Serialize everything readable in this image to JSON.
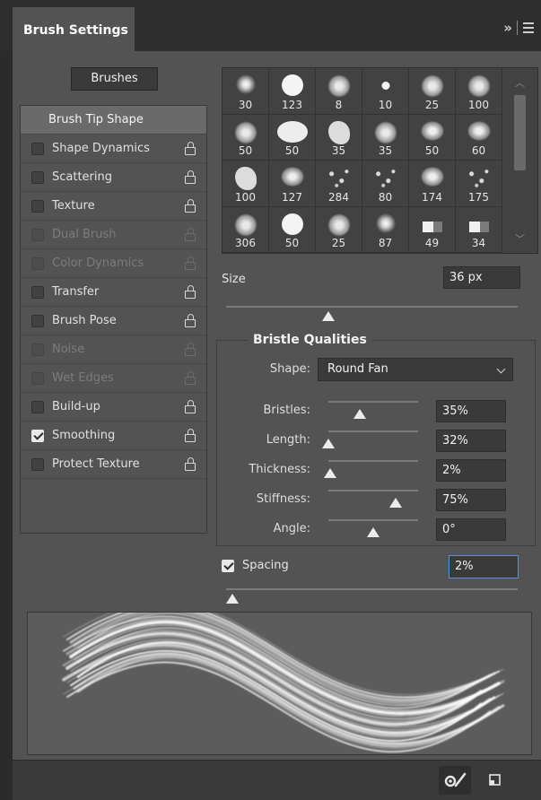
{
  "panel": {
    "tab_title": "Brush Settings",
    "header_icons": [
      "expand-icon",
      "menu-icon"
    ]
  },
  "brushes_button": "Brushes",
  "options": [
    {
      "label": "Brush Tip Shape",
      "selected": true
    },
    {
      "label": "Shape Dynamics",
      "checked": false,
      "enabled": true
    },
    {
      "label": "Scattering",
      "checked": false,
      "enabled": true
    },
    {
      "label": "Texture",
      "checked": false,
      "enabled": true
    },
    {
      "label": "Dual Brush",
      "checked": false,
      "enabled": false
    },
    {
      "label": "Color Dynamics",
      "checked": false,
      "enabled": false
    },
    {
      "label": "Transfer",
      "checked": false,
      "enabled": true
    },
    {
      "label": "Brush Pose",
      "checked": false,
      "enabled": true
    },
    {
      "label": "Noise",
      "checked": false,
      "enabled": false
    },
    {
      "label": "Wet Edges",
      "checked": false,
      "enabled": false
    },
    {
      "label": "Build-up",
      "checked": false,
      "enabled": true
    },
    {
      "label": "Smoothing",
      "checked": true,
      "enabled": true
    },
    {
      "label": "Protect Texture",
      "checked": false,
      "enabled": true
    }
  ],
  "brush_presets": [
    {
      "size": "30",
      "shape": "soft"
    },
    {
      "size": "123",
      "shape": "hard"
    },
    {
      "size": "8",
      "shape": "splat"
    },
    {
      "size": "10",
      "shape": "hard-small"
    },
    {
      "size": "25",
      "shape": "splat"
    },
    {
      "size": "100",
      "shape": "splat"
    },
    {
      "size": "50",
      "shape": "splat"
    },
    {
      "size": "50",
      "shape": "oval"
    },
    {
      "size": "35",
      "shape": "blob"
    },
    {
      "size": "35",
      "shape": "splat"
    },
    {
      "size": "50",
      "shape": "cross"
    },
    {
      "size": "60",
      "shape": "cross"
    },
    {
      "size": "100",
      "shape": "blob"
    },
    {
      "size": "127",
      "shape": "cross"
    },
    {
      "size": "284",
      "shape": "drops"
    },
    {
      "size": "80",
      "shape": "drops"
    },
    {
      "size": "174",
      "shape": "cross"
    },
    {
      "size": "175",
      "shape": "drops"
    },
    {
      "size": "306",
      "shape": "splat"
    },
    {
      "size": "50",
      "shape": "hard"
    },
    {
      "size": "25",
      "shape": "splat"
    },
    {
      "size": "87",
      "shape": "soft"
    },
    {
      "size": "49",
      "shape": "bar"
    },
    {
      "size": "34",
      "shape": "bar"
    }
  ],
  "size": {
    "label": "Size",
    "value": "36 px",
    "level": 0.35
  },
  "bristle": {
    "title": "Bristle Qualities",
    "shape_label": "Shape:",
    "shape_value": "Round Fan",
    "props": [
      {
        "label": "Bristles:",
        "value": "35%",
        "level": 0.35
      },
      {
        "label": "Length:",
        "value": "32%",
        "level": 0.0
      },
      {
        "label": "Thickness:",
        "value": "2%",
        "level": 0.02
      },
      {
        "label": "Stiffness:",
        "value": "75%",
        "level": 0.75
      },
      {
        "label": "Angle:",
        "value": "0°",
        "level": 0.5
      }
    ]
  },
  "spacing": {
    "label": "Spacing",
    "value": "2%",
    "checked": true,
    "level": 0.02
  },
  "footer_icons": [
    "toggle-brush-preview-icon",
    "new-brush-icon"
  ],
  "colors": {
    "panel": "#535353",
    "field": "#3a3a3a",
    "header": "#2e2e2e",
    "focus": "#5a8fd0"
  }
}
